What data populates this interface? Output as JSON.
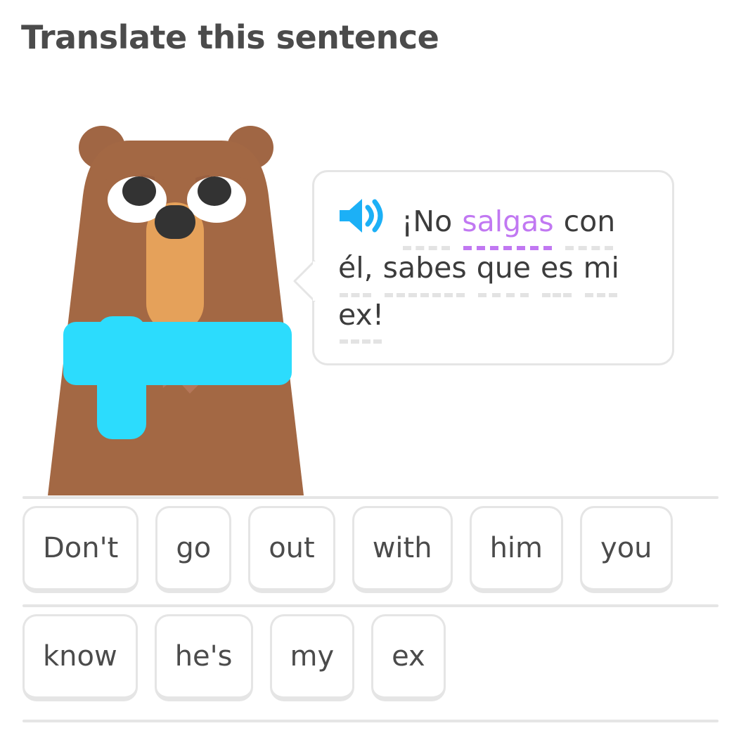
{
  "page": {
    "title": "Translate this sentence"
  },
  "character": {
    "name": "bear-character",
    "colors": {
      "body": "#a36844",
      "ear": "#a06644",
      "muzzle": "#e5a15a",
      "nose": "#333333",
      "eye_white": "#ffffff",
      "pupil": "#333333",
      "brow": "#9a6040",
      "paw": "#b5775a",
      "shirt": "#2cdcfd"
    }
  },
  "prompt": {
    "audio_button_label": "play-audio",
    "sentence_full": "¡No salgas con él, sabes que es mi ex!",
    "lines": [
      {
        "tokens": [
          {
            "text": "¡No",
            "underline": "gray",
            "highlight": false
          },
          {
            "text": "salgas",
            "underline": "purple",
            "highlight": true
          },
          {
            "text": "con",
            "underline": "gray",
            "highlight": false
          }
        ]
      },
      {
        "tokens": [
          {
            "text": "él,",
            "underline": "gray",
            "highlight": false
          },
          {
            "text": "sabes",
            "underline": "gray",
            "highlight": false
          },
          {
            "text": "que",
            "underline": "gray",
            "highlight": false
          },
          {
            "text": "es",
            "underline": "gray",
            "highlight": false
          },
          {
            "text": "mi",
            "underline": "gray",
            "highlight": false
          }
        ]
      },
      {
        "tokens": [
          {
            "text": "ex!",
            "underline": "gray",
            "highlight": false
          }
        ]
      }
    ],
    "highlight_color": "#c178f2",
    "underline_color": "#e3e3e3",
    "speaker_icon_color": "#1cb0f6"
  },
  "word_bank": {
    "rows": [
      {
        "tiles": [
          {
            "label": "Don't"
          },
          {
            "label": "go"
          },
          {
            "label": "out"
          },
          {
            "label": "with"
          },
          {
            "label": "him"
          },
          {
            "label": "you"
          }
        ]
      },
      {
        "tiles": [
          {
            "label": "know"
          },
          {
            "label": "he's"
          },
          {
            "label": "my"
          },
          {
            "label": "ex"
          }
        ]
      }
    ]
  },
  "theme": {
    "text_dark": "#4b4b4b",
    "border_gray": "#e5e5e5",
    "background": "#ffffff"
  }
}
